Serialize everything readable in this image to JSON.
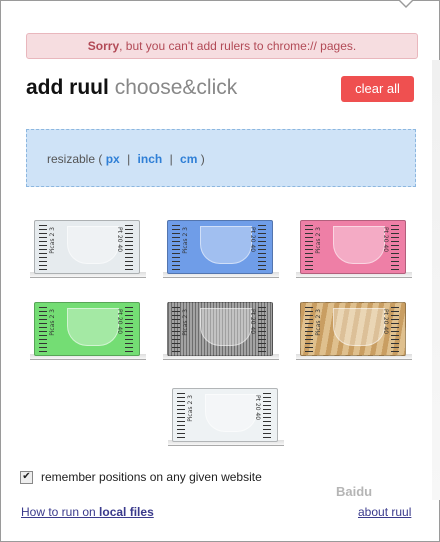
{
  "warning": {
    "strong": "Sorry",
    "text": ", but you can't add rulers to chrome:// pages."
  },
  "header": {
    "title": "add ruul",
    "subtitle": "choose&click",
    "clear_label": "clear all"
  },
  "resizable": {
    "label": "resizable",
    "open": "(",
    "close": ")",
    "units": [
      "px",
      "inch",
      "cm"
    ],
    "sep": "|"
  },
  "rulers": [
    {
      "name": "ruler-white",
      "color": "#e6ebee"
    },
    {
      "name": "ruler-blue",
      "color": "#6f9de8"
    },
    {
      "name": "ruler-pink",
      "color": "#ee7fa6"
    },
    {
      "name": "ruler-green",
      "color": "#74dd74"
    },
    {
      "name": "ruler-gray-stripes",
      "color": "#8a8a8a"
    },
    {
      "name": "ruler-wood",
      "color": "#d6b27a"
    },
    {
      "name": "ruler-clear",
      "color": "#eef2f4"
    }
  ],
  "ruler_labels": {
    "left": "Picas 2 3",
    "right": "Pt 20 40"
  },
  "remember": {
    "label": "remember positions on any given website",
    "checked": true
  },
  "footer": {
    "help_prefix": "How to run on ",
    "help_bold": "local files",
    "about": "about ruul"
  },
  "watermark": "Baidu"
}
